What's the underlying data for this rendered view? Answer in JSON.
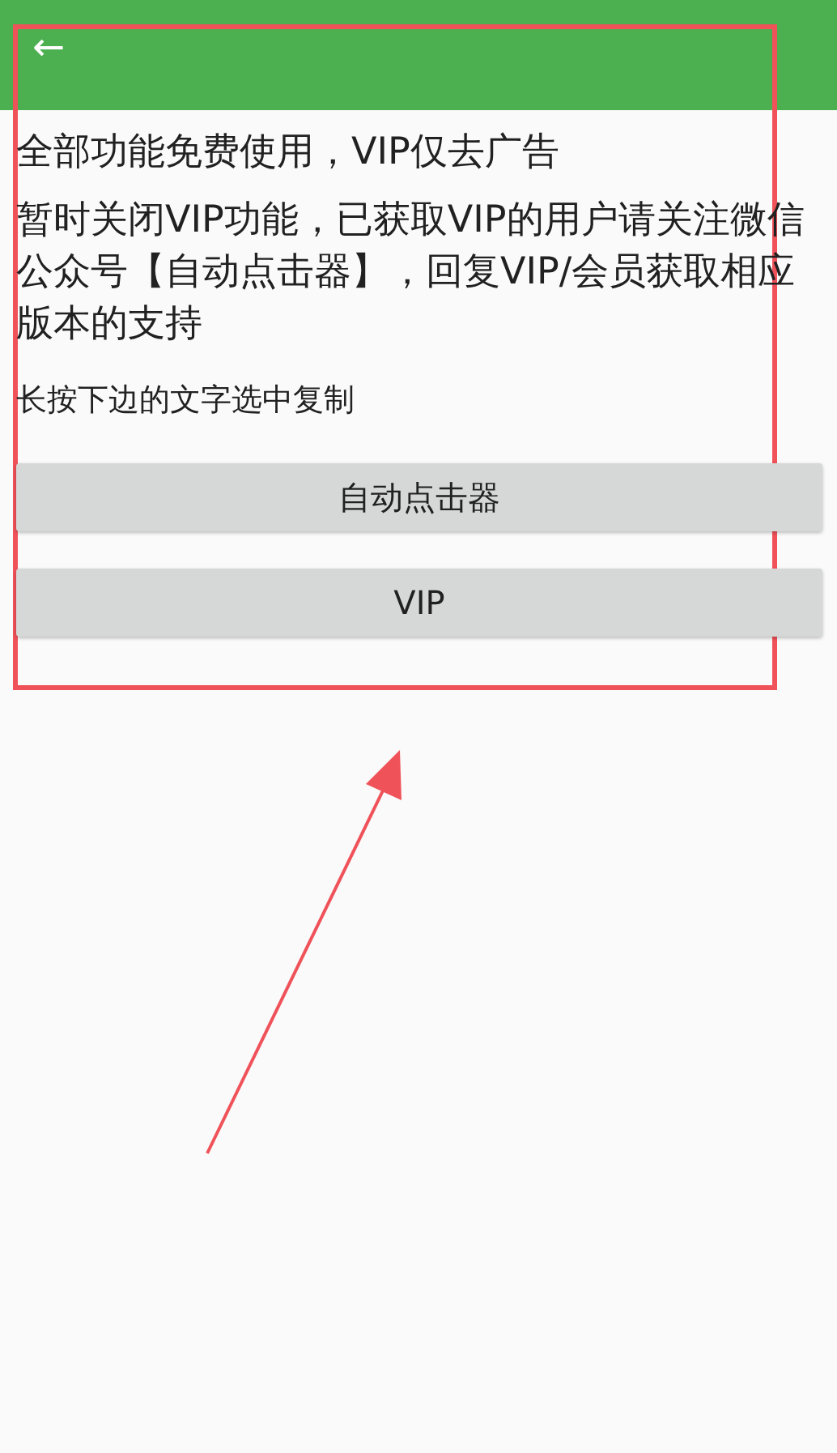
{
  "app_bar": {
    "back": "←"
  },
  "paragraphs": [
    {
      "text": "全部功能免费使用，VIP仅去广告"
    },
    {
      "text": "暂时关闭VIP功能，已获取VIP的用户请关注微信公众号【自动点击器】，回复VIP/会员获取相应版本的支持"
    },
    {
      "text": "长按下边的文字选中复制",
      "kind": "hint"
    }
  ],
  "buttons": [
    "自动点击器",
    "VIP"
  ]
}
